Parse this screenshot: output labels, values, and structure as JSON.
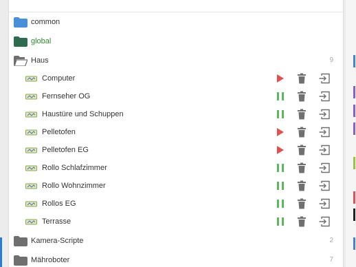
{
  "tree": {
    "top_folders": [
      {
        "name": "common"
      },
      {
        "name": "global"
      },
      {
        "name": "Haus",
        "count": "9"
      }
    ],
    "scripts": [
      {
        "name": "Computer",
        "status": "stopped"
      },
      {
        "name": "Fernseher OG",
        "status": "running"
      },
      {
        "name": "Haustüre und Schuppen",
        "status": "running"
      },
      {
        "name": "Pelletofen",
        "status": "stopped"
      },
      {
        "name": "Pelletofen EG",
        "status": "stopped"
      },
      {
        "name": "Rollo Schlafzimmer",
        "status": "running"
      },
      {
        "name": "Rollo Wohnzimmer",
        "status": "running"
      },
      {
        "name": "Rollos EG",
        "status": "running"
      },
      {
        "name": "Terrasse",
        "status": "running"
      }
    ],
    "bottom_folders": [
      {
        "name": "Kamera-Scripte",
        "count": "2"
      },
      {
        "name": "Mähroboter",
        "count": "7"
      }
    ]
  },
  "colors": {
    "common_folder": "#4a90d9",
    "global_folder": "#2e6b4f",
    "global_text": "#2e8b2e",
    "closed_folder": "#6f6f6f",
    "open_folder": "#6f6f6f",
    "play_icon": "#e05252",
    "pause_icon": "#5cb85c",
    "trash_icon": "#707070",
    "move_icon": "#707070",
    "script_icon": "#8aa84f",
    "count_text": "#aaaaaa"
  },
  "icons": {
    "common": "folder-icon",
    "global": "folder-icon",
    "Haus": "folder-open-icon",
    "script": "javascript-file-icon",
    "running": "pause-icon",
    "stopped": "play-icon",
    "delete": "trash-icon",
    "move": "move-to-icon"
  }
}
